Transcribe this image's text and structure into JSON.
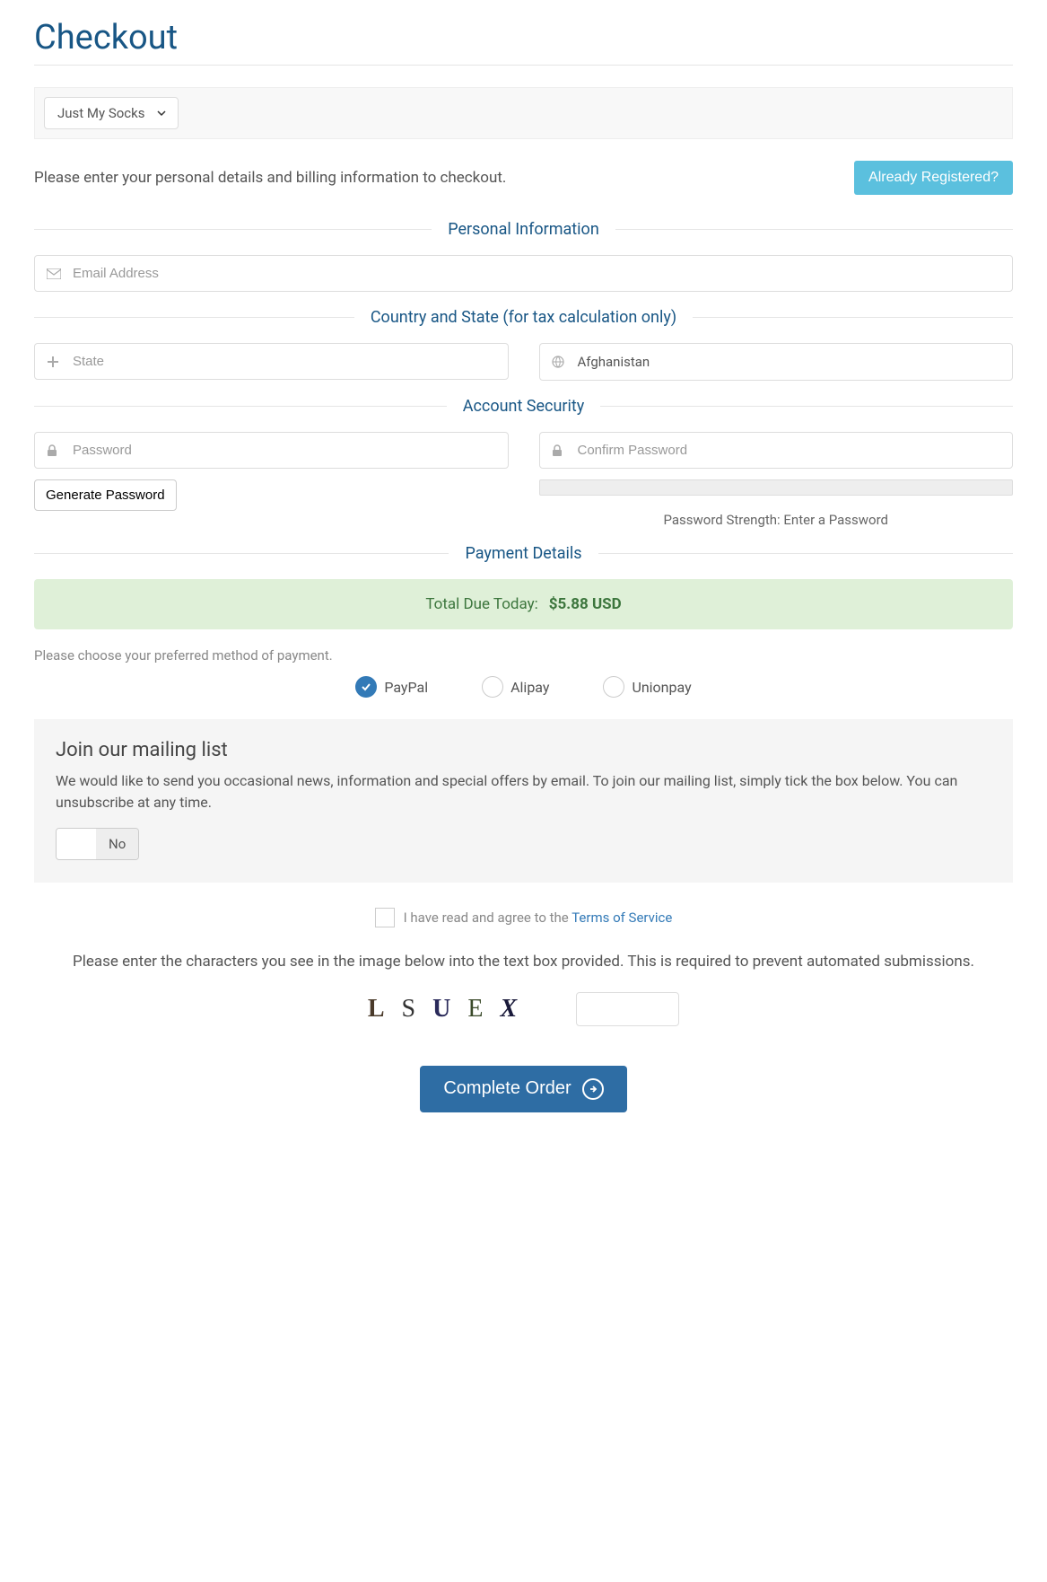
{
  "page_title": "Checkout",
  "product_select": "Just My Socks",
  "intro_text": "Please enter your personal details and billing information to checkout.",
  "already_registered": "Already Registered?",
  "sections": {
    "personal": "Personal Information",
    "country": "Country and State (for tax calculation only)",
    "security": "Account Security",
    "payment": "Payment Details"
  },
  "placeholders": {
    "email": "Email Address",
    "state": "State",
    "password": "Password",
    "confirm": "Confirm Password"
  },
  "country_value": "Afghanistan",
  "generate_password": "Generate Password",
  "password_strength": "Password Strength: Enter a Password",
  "total_label": "Total Due Today:",
  "total_value": "$5.88 USD",
  "payment_hint": "Please choose your preferred method of payment.",
  "payment_methods": [
    {
      "name": "paypal",
      "label": "PayPal",
      "selected": true
    },
    {
      "name": "alipay",
      "label": "Alipay",
      "selected": false
    },
    {
      "name": "unionpay",
      "label": "Unionpay",
      "selected": false
    }
  ],
  "mailing": {
    "title": "Join our mailing list",
    "text": "We would like to send you occasional news, information and special offers by email. To join our mailing list, simply tick the box below. You can unsubscribe at any time.",
    "no": "No"
  },
  "tos": {
    "prefix": "I have read and agree to the ",
    "link": "Terms of Service"
  },
  "captcha": {
    "text": "Please enter the characters you see in the image below into the text box provided. This is required to prevent automated submissions.",
    "chars": [
      "L",
      "S",
      "U",
      "E",
      "X"
    ]
  },
  "submit": "Complete Order"
}
